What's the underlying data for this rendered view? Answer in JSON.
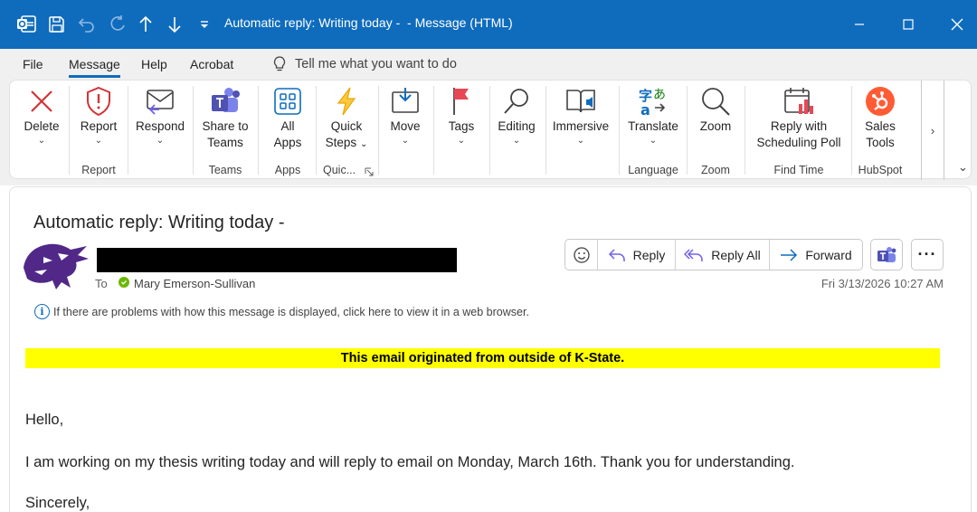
{
  "window": {
    "title": "Automatic reply: Writing today -  - Message (HTML)",
    "accent": "#0f6cbd"
  },
  "menu": {
    "items": [
      "File",
      "Message",
      "Help",
      "Acrobat"
    ],
    "active": "Message",
    "tell_me": "Tell me what you want to do"
  },
  "ribbon": {
    "buttons": {
      "delete": "Delete",
      "report": "Report",
      "respond": "Respond",
      "share_teams_1": "Share to",
      "share_teams_2": "Teams",
      "all_apps_1": "All",
      "all_apps_2": "Apps",
      "quick_steps_1": "Quick",
      "quick_steps_2": "Steps",
      "move": "Move",
      "tags": "Tags",
      "editing": "Editing",
      "immersive": "Immersive",
      "translate": "Translate",
      "zoom": "Zoom",
      "scheduling_1": "Reply with",
      "scheduling_2": "Scheduling Poll",
      "sales_1": "Sales",
      "sales_2": "Tools"
    },
    "groups": {
      "report": "Report",
      "teams": "Teams",
      "apps": "Apps",
      "quick": "Quic...",
      "language": "Language",
      "zoom": "Zoom",
      "find_time": "Find Time",
      "hubspot": "HubSpot"
    }
  },
  "message": {
    "subject": "Automatic reply: Writing today -",
    "to_label": "To",
    "recipient": "Mary Emerson-Sullivan",
    "date": "Fri 3/13/2026 10:27 AM",
    "info_bar": "If there are problems with how this message is displayed, click here to view it in a web browser.",
    "actions": {
      "reply": "Reply",
      "reply_all": "Reply All",
      "forward": "Forward"
    },
    "external_banner": "This email originated from outside of K-State.",
    "banner_color": "#ffff00",
    "body": {
      "greeting": "Hello,",
      "paragraph": "I am working on my thesis writing today and will reply to email on Monday, March 16th. Thank you for understanding.",
      "closing": "Sincerely,"
    }
  }
}
